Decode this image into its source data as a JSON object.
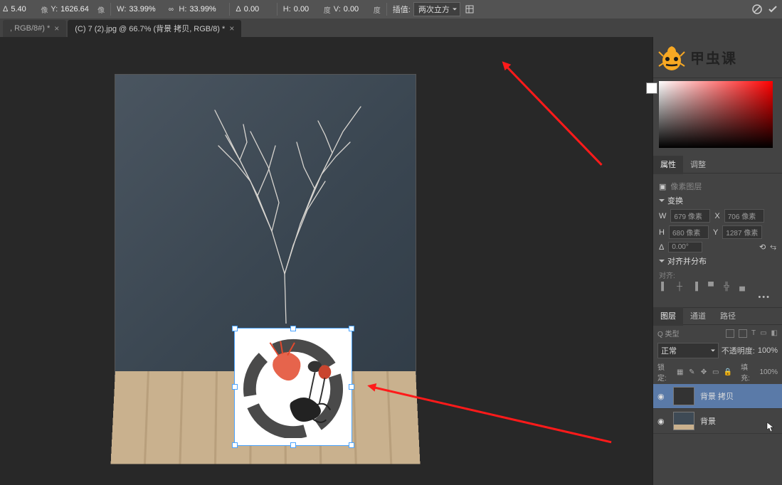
{
  "brand": "甲虫课",
  "topbar": {
    "x_label": "Δ",
    "x_val": "5.40",
    "x_unit": "像",
    "y_label": "Y:",
    "y_val": "1626.64",
    "y_unit": "像",
    "w_label": "W:",
    "w_val": "33.99%",
    "h_label": "H:",
    "h_val": "33.99%",
    "ang_label": "Δ",
    "ang_val": "0.00",
    "hshear_label": "H:",
    "hshear_val": "0.00",
    "hshear_unit": "度",
    "vshear_label": "V:",
    "vshear_val": "0.00",
    "vshear_unit": "度",
    "interp_label": "插值:",
    "interp_val": "两次立方"
  },
  "tabs": [
    {
      "label": ", RGB/8#) *"
    },
    {
      "label": "(C) 7 (2).jpg @ 66.7% (背景 拷贝, RGB/8) *"
    }
  ],
  "propsTabs": {
    "t1": "属性",
    "t2": "调整"
  },
  "props": {
    "pixelLayer": "像素图层",
    "transform_hd": "变换",
    "w_lbl": "W",
    "w_val": "679 像素",
    "x_lbl": "X",
    "x_val": "706 像素",
    "h_lbl": "H",
    "h_val": "680 像素",
    "y_lbl": "Y",
    "y_val": "1287 像素",
    "angle_lbl": "Δ",
    "angle_val": "0.00°",
    "align_hd": "对齐并分布",
    "align_to": "对齐:"
  },
  "layersTabs": {
    "t1": "图层",
    "t2": "通道",
    "t3": "路径"
  },
  "layersPanel": {
    "kind": "Q 类型",
    "blend": "正常",
    "opacity_lbl": "不透明度:",
    "opacity_val": "100%",
    "lock_lbl": "锁定:",
    "fill_lbl": "填充:",
    "fill_val": "100%",
    "layer1": "背景 拷贝",
    "layer2": "背景"
  }
}
